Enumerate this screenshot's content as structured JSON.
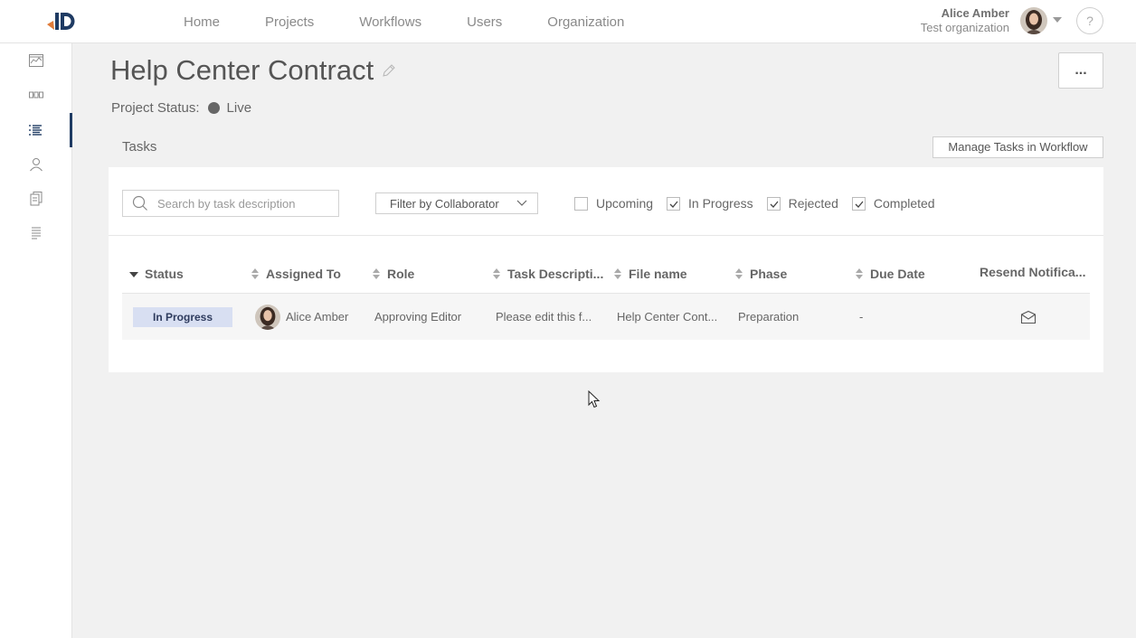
{
  "nav": {
    "items": [
      {
        "label": "Home"
      },
      {
        "label": "Projects"
      },
      {
        "label": "Workflows"
      },
      {
        "label": "Users"
      },
      {
        "label": "Organization"
      }
    ]
  },
  "user": {
    "name": "Alice Amber",
    "organization": "Test organization"
  },
  "help": {
    "label": "?"
  },
  "sidebar": {
    "items": [
      {
        "icon": "chart-icon"
      },
      {
        "icon": "workflow-icon"
      },
      {
        "icon": "task-list-icon",
        "active": true
      },
      {
        "icon": "person-icon"
      },
      {
        "icon": "documents-icon"
      },
      {
        "icon": "log-icon"
      }
    ]
  },
  "header": {
    "title": "Help Center Contract",
    "more_label": "...",
    "status_label": "Project Status:",
    "status_value": "Live"
  },
  "tasks": {
    "section_label": "Tasks",
    "manage_label": "Manage Tasks in Workflow",
    "search_placeholder": "Search by task description",
    "filter_label": "Filter by Collaborator",
    "checkboxes": [
      {
        "label": "Upcoming",
        "checked": false
      },
      {
        "label": "In Progress",
        "checked": true
      },
      {
        "label": "Rejected",
        "checked": true
      },
      {
        "label": "Completed",
        "checked": true
      }
    ],
    "columns": [
      "Status",
      "Assigned To",
      "Role",
      "Task Descripti...",
      "File name",
      "Phase",
      "Due Date",
      "Resend Notifica..."
    ],
    "rows": [
      {
        "status": "In Progress",
        "assigned_to": "Alice Amber",
        "role": "Approving Editor",
        "description": "Please edit this f...",
        "file_name": "Help Center Cont...",
        "phase": "Preparation",
        "due_date": "-"
      }
    ]
  },
  "colors": {
    "accent": "#1f3b63",
    "badge_bg": "#d8dff2",
    "badge_text": "#2e3b5e",
    "logo_orange": "#e07b39"
  }
}
